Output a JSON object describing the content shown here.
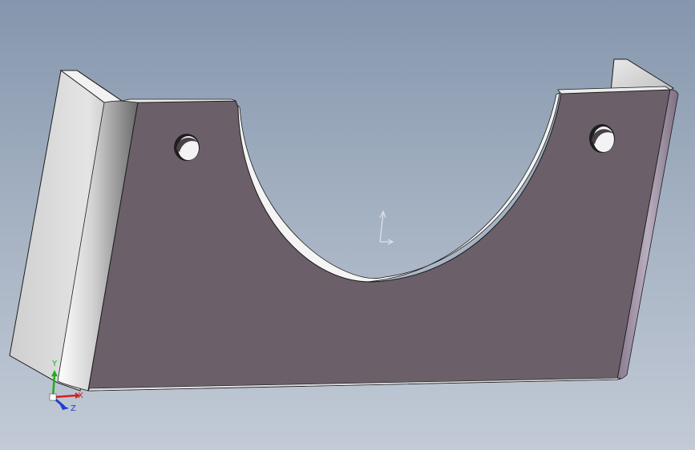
{
  "viewport": {
    "background_top": "#8596ad",
    "background_bottom": "#c2cad6"
  },
  "model": {
    "face_color": "#6b5f69",
    "flange_color": "#d8d8d8",
    "edge_color": "#1c1c1c",
    "hole_count": 2
  },
  "triad": {
    "x_label": "X",
    "y_label": "Y",
    "z_label": "Z",
    "x_color": "#d42020",
    "y_color": "#1fae1f",
    "z_color": "#1f3fcf"
  },
  "origin_marker": {
    "color": "#dfe3ea"
  }
}
